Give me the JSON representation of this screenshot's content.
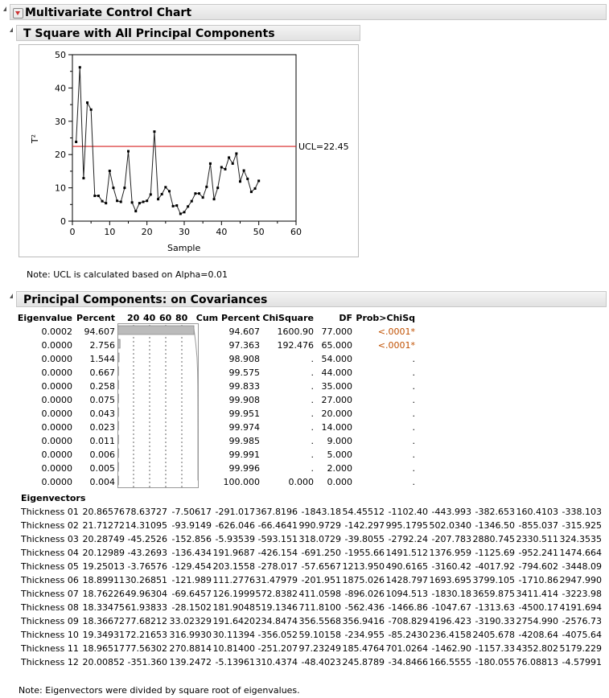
{
  "report": {
    "title": "Multivariate Control Chart"
  },
  "tsquare": {
    "title": "T Square with All Principal Components",
    "note": "Note: UCL is calculated based on Alpha=0.01",
    "ucl_label": "UCL=22.45"
  },
  "chart_data": {
    "type": "line",
    "xlabel": "Sample",
    "ylabel": "T²",
    "xlim": [
      0,
      60
    ],
    "ylim": [
      0,
      50
    ],
    "xticks": [
      0,
      10,
      20,
      30,
      40,
      50,
      60
    ],
    "yticks": [
      0,
      10,
      20,
      30,
      40,
      50
    ],
    "ucl": 22.45,
    "ucl_color": "#d62020",
    "x": [
      1,
      2,
      3,
      4,
      5,
      6,
      7,
      8,
      9,
      10,
      11,
      12,
      13,
      14,
      15,
      16,
      17,
      18,
      19,
      20,
      21,
      22,
      23,
      24,
      25,
      26,
      27,
      28,
      29,
      30,
      31,
      32,
      33,
      34,
      35,
      36,
      37,
      38,
      39,
      40,
      41,
      42,
      43,
      44,
      45,
      46,
      47,
      48,
      49,
      50
    ],
    "y": [
      23.8,
      46.2,
      12.9,
      35.6,
      33.5,
      7.6,
      7.6,
      6.0,
      5.4,
      15.1,
      10.0,
      6.1,
      5.8,
      10.0,
      21.0,
      5.6,
      3.0,
      5.4,
      5.8,
      6.1,
      8.0,
      26.9,
      6.6,
      8.1,
      10.2,
      9.0,
      4.5,
      4.7,
      2.2,
      2.7,
      4.4,
      6.0,
      8.3,
      8.3,
      7.1,
      10.3,
      17.3,
      6.6,
      10.0,
      16.2,
      15.6,
      19.1,
      17.3,
      20.3,
      11.9,
      15.2,
      12.7,
      8.8,
      9.8,
      12.1
    ]
  },
  "pca": {
    "title": "Principal Components: on Covariances",
    "headers": {
      "eigenvalue": "Eigenvalue",
      "percent": "Percent",
      "bar_ticks": [
        "20",
        "40",
        "60",
        "80"
      ],
      "cum": "Cum Percent",
      "chisq": "ChiSquare",
      "df": "DF",
      "prob": "Prob>ChiSq"
    },
    "rows": [
      {
        "eig": "0.0002",
        "pct": "94.607",
        "cum": "94.607",
        "chi": "1600.90",
        "df": "77.000",
        "prob": "<.0001*"
      },
      {
        "eig": "0.0000",
        "pct": "2.756",
        "cum": "97.363",
        "chi": "192.476",
        "df": "65.000",
        "prob": "<.0001*"
      },
      {
        "eig": "0.0000",
        "pct": "1.544",
        "cum": "98.908",
        "chi": ".",
        "df": "54.000",
        "prob": "."
      },
      {
        "eig": "0.0000",
        "pct": "0.667",
        "cum": "99.575",
        "chi": ".",
        "df": "44.000",
        "prob": "."
      },
      {
        "eig": "0.0000",
        "pct": "0.258",
        "cum": "99.833",
        "chi": ".",
        "df": "35.000",
        "prob": "."
      },
      {
        "eig": "0.0000",
        "pct": "0.075",
        "cum": "99.908",
        "chi": ".",
        "df": "27.000",
        "prob": "."
      },
      {
        "eig": "0.0000",
        "pct": "0.043",
        "cum": "99.951",
        "chi": ".",
        "df": "20.000",
        "prob": "."
      },
      {
        "eig": "0.0000",
        "pct": "0.023",
        "cum": "99.974",
        "chi": ".",
        "df": "14.000",
        "prob": "."
      },
      {
        "eig": "0.0000",
        "pct": "0.011",
        "cum": "99.985",
        "chi": ".",
        "df": "9.000",
        "prob": "."
      },
      {
        "eig": "0.0000",
        "pct": "0.006",
        "cum": "99.991",
        "chi": ".",
        "df": "5.000",
        "prob": "."
      },
      {
        "eig": "0.0000",
        "pct": "0.005",
        "cum": "99.996",
        "chi": ".",
        "df": "2.000",
        "prob": "."
      },
      {
        "eig": "0.0000",
        "pct": "0.004",
        "cum": "100.000",
        "chi": "0.000",
        "df": "0.000",
        "prob": "."
      }
    ],
    "sig_color": "#c05000",
    "eigenvectors_title": "Eigenvectors",
    "eigenvectors": [
      [
        "Thickness 01",
        "20.86576",
        "78.63727",
        "-7.50617",
        "-291.017",
        "367.8196",
        "-1843.18",
        "54.45512",
        "-1102.40",
        "-443.993",
        "-382.653",
        "160.4103",
        "-338.103"
      ],
      [
        "Thickness 02",
        "21.71272",
        "14.31095",
        "-93.9149",
        "-626.046",
        "-66.4641",
        "990.9729",
        "-142.297",
        "995.1795",
        "502.0340",
        "-1346.50",
        "-855.037",
        "-315.925"
      ],
      [
        "Thickness 03",
        "20.28749",
        "-45.2526",
        "-152.856",
        "-5.93539",
        "-593.151",
        "318.0729",
        "-39.8055",
        "-2792.24",
        "-207.783",
        "2880.745",
        "2330.511",
        "324.3535"
      ],
      [
        "Thickness 04",
        "20.12989",
        "-43.2693",
        "-136.434",
        "191.9687",
        "-426.154",
        "-691.250",
        "-1955.66",
        "1491.512",
        "1376.959",
        "-1125.69",
        "-952.241",
        "1474.664"
      ],
      [
        "Thickness 05",
        "19.25013",
        "-3.76576",
        "-129.454",
        "203.1558",
        "-278.017",
        "-57.6567",
        "1213.950",
        "490.6165",
        "-3160.42",
        "-4017.92",
        "-794.602",
        "-3448.09"
      ],
      [
        "Thickness 06",
        "18.89911",
        "30.26851",
        "-121.989",
        "111.2776",
        "31.47979",
        "-201.951",
        "1875.026",
        "1428.797",
        "1693.695",
        "3799.105",
        "-1710.86",
        "2947.990"
      ],
      [
        "Thickness 07",
        "18.76226",
        "49.96304",
        "-69.6457",
        "126.1999",
        "572.8382",
        "411.0598",
        "-896.026",
        "1094.513",
        "-1830.18",
        "3659.875",
        "3411.414",
        "-3223.98"
      ],
      [
        "Thickness 08",
        "18.33475",
        "61.93833",
        "-28.1502",
        "181.9048",
        "519.1346",
        "711.8100",
        "-562.436",
        "-1466.86",
        "-1047.67",
        "-1313.63",
        "-4500.17",
        "4191.694"
      ],
      [
        "Thickness 09",
        "18.36672",
        "77.68212",
        "33.02329",
        "191.6420",
        "234.8474",
        "356.5568",
        "356.9416",
        "-708.829",
        "4196.423",
        "-3190.33",
        "2754.990",
        "-2576.73"
      ],
      [
        "Thickness 10",
        "19.34931",
        "72.21653",
        "316.9930",
        "30.11394",
        "-356.052",
        "59.10158",
        "-234.955",
        "-85.2430",
        "236.4158",
        "2405.678",
        "-4208.64",
        "-4075.64"
      ],
      [
        "Thickness 11",
        "18.96517",
        "77.56302",
        "270.8814",
        "10.81400",
        "-251.207",
        "97.23249",
        "185.4764",
        "701.0264",
        "-1462.90",
        "-1157.33",
        "4352.802",
        "5179.229"
      ],
      [
        "Thickness 12",
        "20.00852",
        "-351.360",
        "139.2472",
        "-5.13961",
        "310.4374",
        "-48.4023",
        "245.8789",
        "-34.8466",
        "166.5555",
        "-180.055",
        "76.08813",
        "-4.57991"
      ]
    ],
    "note": "Note: Eigenvectors were divided by square root of eigenvalues."
  }
}
